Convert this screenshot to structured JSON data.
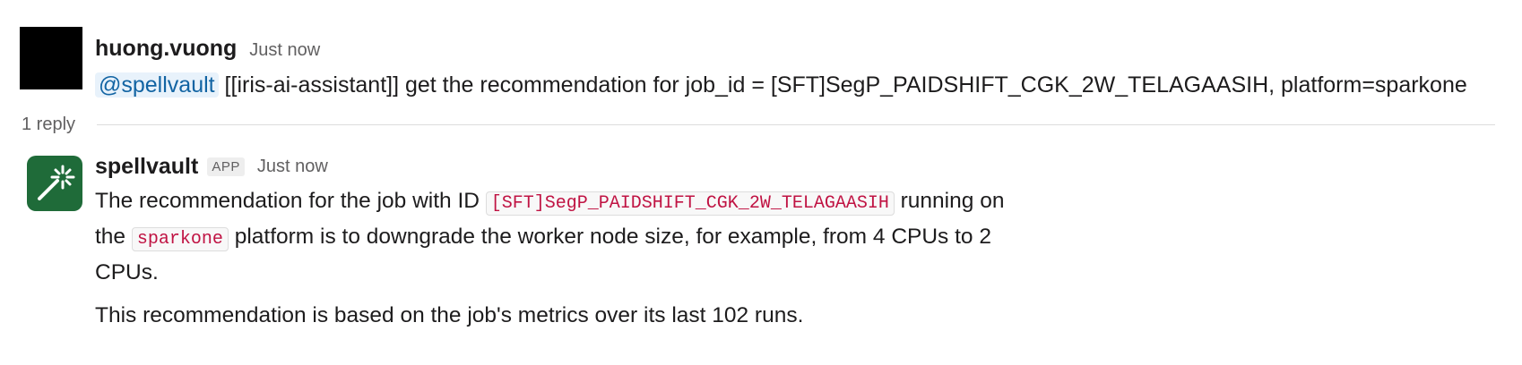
{
  "message1": {
    "author": "huong.vuong",
    "time": "Just now",
    "mention": "@spellvault",
    "text": " [[iris-ai-assistant]] get the recommendation for job_id = [SFT]SegP_PAIDSHIFT_CGK_2W_TELAGAASIH, platform=sparkone"
  },
  "thread": {
    "reply_count": "1 reply"
  },
  "message2": {
    "author": "spellvault",
    "badge": "APP",
    "time": "Just now",
    "p1_a": "The recommendation for the job with ID ",
    "code1": "[SFT]SegP_PAIDSHIFT_CGK_2W_TELAGAASIH",
    "p1_b": " running on the ",
    "code2": "sparkone",
    "p1_c": " platform is to downgrade the worker node size, for example, from 4 CPUs to 2 CPUs.",
    "p2": "This recommendation is based on the job's metrics over its last 102 runs."
  },
  "colors": {
    "app_avatar": "#1f6b39",
    "mention_text": "#1264a3",
    "code_text": "#c01343"
  }
}
